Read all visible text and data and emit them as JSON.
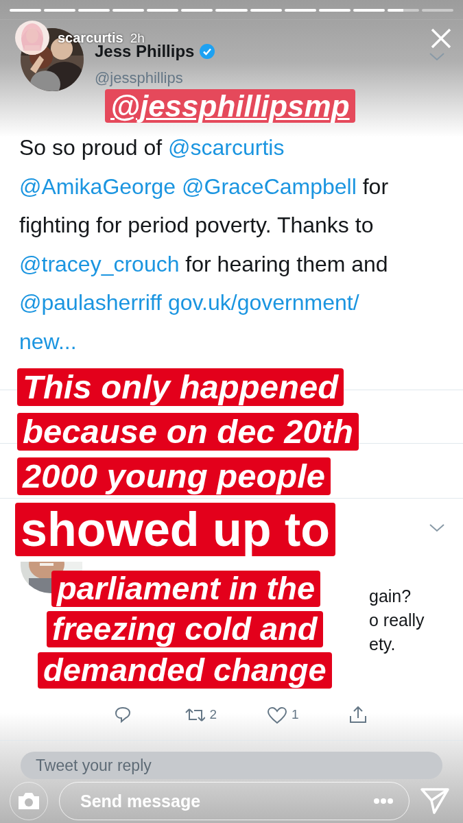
{
  "story_progress": [
    {
      "level": 1
    },
    {
      "level": 1
    },
    {
      "level": 1
    },
    {
      "level": 1
    },
    {
      "level": 1
    },
    {
      "level": 1
    },
    {
      "level": 1
    },
    {
      "level": 1
    },
    {
      "level": 1
    },
    {
      "level": 1
    },
    {
      "level": 1
    },
    {
      "level": 0.5
    },
    {
      "level": 0
    }
  ],
  "story_header": {
    "username": "scarcurtis",
    "time": "2h"
  },
  "tweet": {
    "name": "Jess Phillips",
    "verified": true,
    "handle": "@jessphillips",
    "text_lines": [
      [
        {
          "text": "So so proud of ",
          "link": false
        },
        {
          "text": "@scarcurtis",
          "link": true
        }
      ],
      [
        {
          "text": "@AmikaGeorge",
          "link": true
        },
        {
          "text": "@GraceCampbell",
          "link": true
        },
        {
          "text": " for",
          "link": false
        }
      ],
      [
        {
          "text": "fighting for period poverty. Thanks to",
          "link": false
        }
      ],
      [
        {
          "text": "@tracey_crouch",
          "link": true
        },
        {
          "text": " for hearing them and",
          "link": false
        }
      ],
      [
        {
          "text": "@paulasherriff",
          "link": true
        },
        {
          "text": "gov.uk/government/",
          "link": true
        }
      ],
      [
        {
          "text": "new...",
          "link": true
        }
      ]
    ]
  },
  "reply": {
    "visible_fragments": [
      "gain?",
      "o really",
      "ety."
    ],
    "actions": [
      {
        "kind": "reply"
      },
      {
        "kind": "retweet",
        "count": "2"
      },
      {
        "kind": "like",
        "count": "1"
      },
      {
        "kind": "share"
      }
    ],
    "reply_field": {
      "placeholder": "Tweet your reply"
    }
  },
  "stickers": [
    {
      "kind": "mention",
      "text": "@jessphillipsmp"
    },
    {
      "kind": "caption",
      "text": "This only happened"
    },
    {
      "kind": "caption",
      "text": "because on dec 20th"
    },
    {
      "kind": "caption",
      "text": "2000 young people"
    },
    {
      "kind": "caption-large",
      "text": "showed up to"
    },
    {
      "kind": "caption",
      "text": "parliament in the"
    },
    {
      "kind": "caption",
      "text": "freezing cold and"
    },
    {
      "kind": "caption",
      "text": "demanded change"
    }
  ],
  "message_bar": {
    "placeholder": "Send message"
  }
}
